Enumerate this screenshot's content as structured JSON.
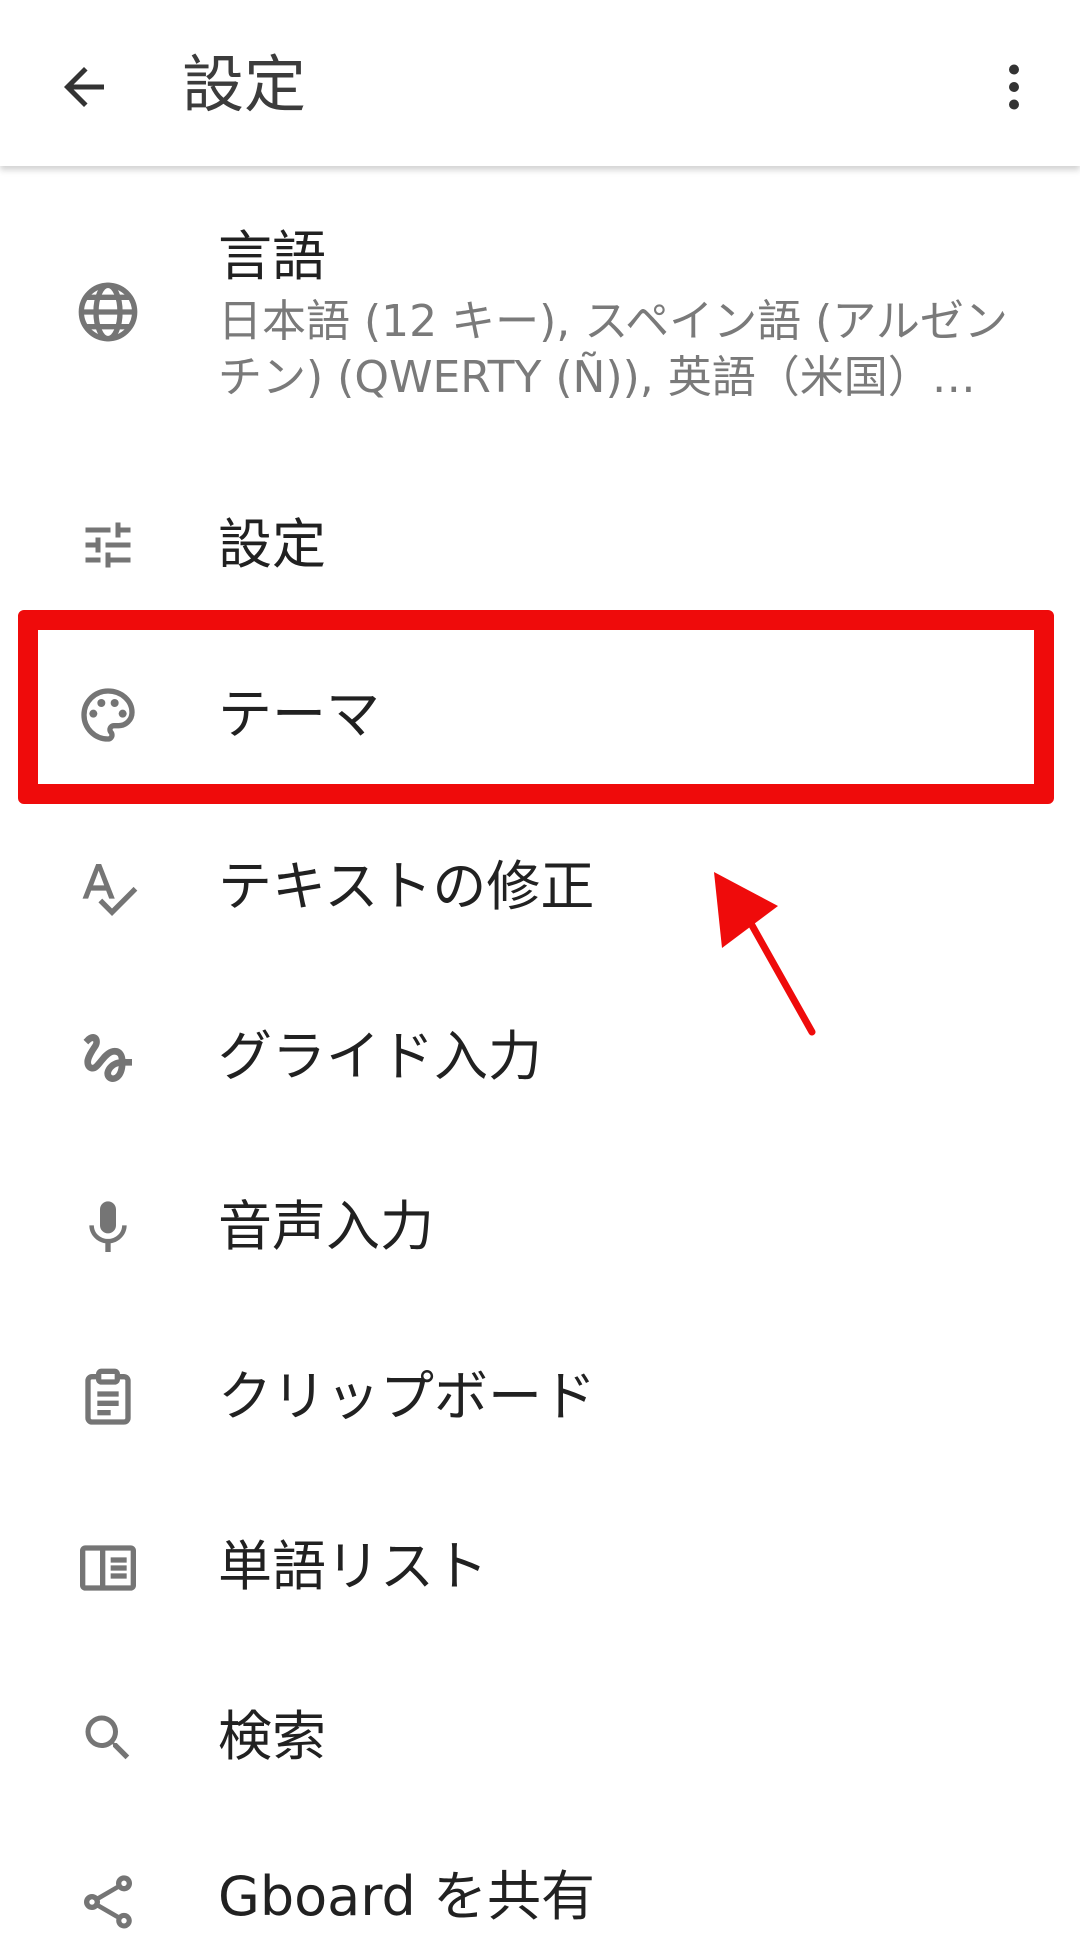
{
  "appbar": {
    "title": "設定",
    "back_icon": "arrow-back-icon",
    "more_icon": "more-vert-icon"
  },
  "items": [
    {
      "label": "言語",
      "summary": "日本語 (12 キー), スペイン語 (アルゼンチン) (QWERTY (Ñ)), 英語（米国）…",
      "icon": "globe-icon"
    },
    {
      "label": "設定",
      "icon": "tune-icon"
    },
    {
      "label": "テーマ",
      "icon": "palette-icon"
    },
    {
      "label": "テキストの修正",
      "icon": "spellcheck-icon"
    },
    {
      "label": "グライド入力",
      "icon": "gesture-icon"
    },
    {
      "label": "音声入力",
      "icon": "mic-icon"
    },
    {
      "label": "クリップボード",
      "icon": "clipboard-icon"
    },
    {
      "label": "単語リスト",
      "icon": "dictionary-icon"
    },
    {
      "label": "検索",
      "icon": "search-icon"
    },
    {
      "label": "Gboard を共有",
      "icon": "share-icon"
    }
  ],
  "colors": {
    "highlight": "#ef0b0b",
    "icon": "#757575",
    "text": "#212121",
    "summary": "#7a7a7a"
  }
}
